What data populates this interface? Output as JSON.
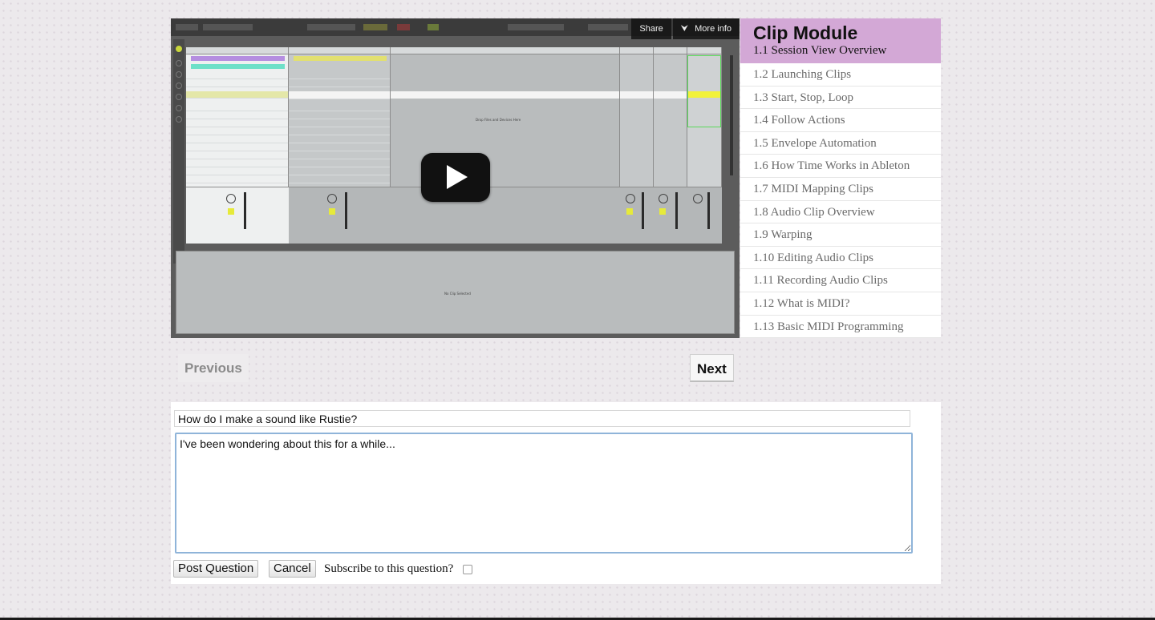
{
  "video": {
    "share_label": "Share",
    "more_info_label": "More info",
    "play_icon": "play-icon",
    "more_icon": "double-chevron-down-icon"
  },
  "module": {
    "title": "Clip Module",
    "current": "1.1 Session View Overview",
    "items": [
      "1.2 Launching Clips",
      "1.3 Start, Stop, Loop",
      "1.4 Follow Actions",
      "1.5 Envelope Automation",
      "1.6 How Time Works in Ableton",
      "1.7 MIDI Mapping Clips",
      "1.8 Audio Clip Overview",
      "1.9 Warping",
      "1.10 Editing Audio Clips",
      "1.11 Recording Audio Clips",
      "1.12 What is MIDI?",
      "1.13 Basic MIDI Programming"
    ],
    "header_color": "#d3a8d6"
  },
  "nav": {
    "previous_label": "Previous",
    "next_label": "Next"
  },
  "question_form": {
    "title_value": "How do I make a sound like Rustie?",
    "body_value": "I've been wondering about this for a while...",
    "post_label": "Post Question",
    "cancel_label": "Cancel",
    "subscribe_label": "Subscribe to this question?",
    "subscribe_checked": false
  }
}
